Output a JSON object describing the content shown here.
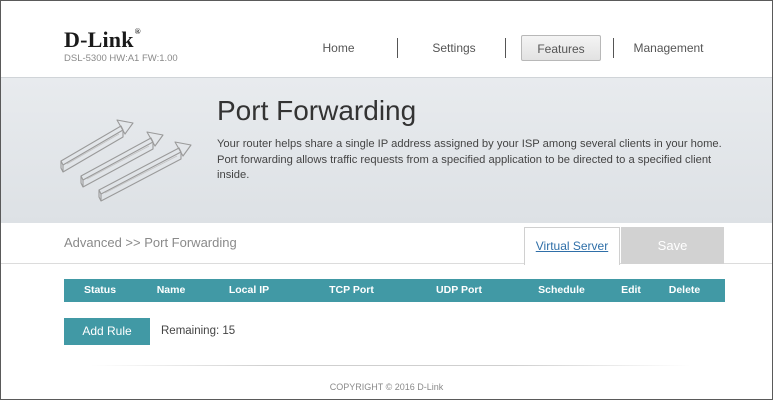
{
  "header": {
    "logo": "D-Link",
    "logo_mark": "®",
    "model": "DSL-5300 HW:A1 FW:1.00"
  },
  "nav": {
    "items": [
      {
        "label": "Home"
      },
      {
        "label": "Settings"
      },
      {
        "label": "Features",
        "active": true
      },
      {
        "label": "Management"
      }
    ]
  },
  "banner": {
    "title": "Port Forwarding",
    "description": "Your router helps share a single IP address assigned by your ISP among several clients in your home. Port forwarding allows traffic requests from a specified application to be directed to a specified client inside."
  },
  "breadcrumb": {
    "text": "Advanced >> Port Forwarding",
    "virtual_server_link": "Virtual Server",
    "save_label": "Save"
  },
  "table": {
    "columns": [
      "Status",
      "Name",
      "Local IP",
      "TCP Port",
      "UDP Port",
      "Schedule",
      "Edit",
      "Delete"
    ],
    "rows": []
  },
  "actions": {
    "add_rule_label": "Add Rule",
    "remaining_text": "Remaining: 15"
  },
  "footer": {
    "copyright": "COPYRIGHT © 2016 D-Link"
  },
  "colors": {
    "accent": "#4199a5",
    "save_disabled": "#d2d2d2",
    "link": "#2f6fa8"
  }
}
